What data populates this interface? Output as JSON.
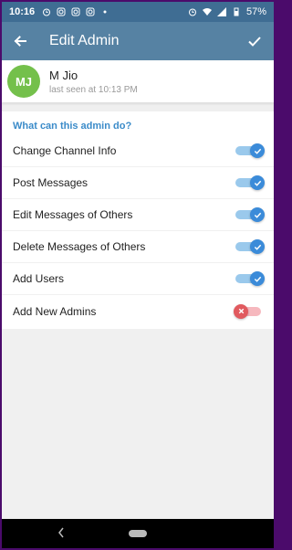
{
  "status_bar": {
    "time": "10:16",
    "battery": "57%"
  },
  "appbar": {
    "title": "Edit Admin"
  },
  "profile": {
    "initials": "MJ",
    "name": "M Jio",
    "status": "last seen at 10:13 PM",
    "avatar_color": "#74c04b"
  },
  "permissions": {
    "header": "What can this admin do?",
    "items": [
      {
        "label": "Change Channel Info",
        "enabled": true
      },
      {
        "label": "Post Messages",
        "enabled": true
      },
      {
        "label": "Edit Messages of Others",
        "enabled": true
      },
      {
        "label": "Delete Messages of Others",
        "enabled": true
      },
      {
        "label": "Add Users",
        "enabled": true
      },
      {
        "label": "Add New Admins",
        "enabled": false
      }
    ]
  },
  "colors": {
    "appbar": "#5682a3",
    "statusbar": "#3f6d93",
    "accent": "#3b8bd9",
    "off": "#e15a5f"
  },
  "icons": {
    "back": "arrow-left-icon",
    "confirm": "check-icon"
  }
}
